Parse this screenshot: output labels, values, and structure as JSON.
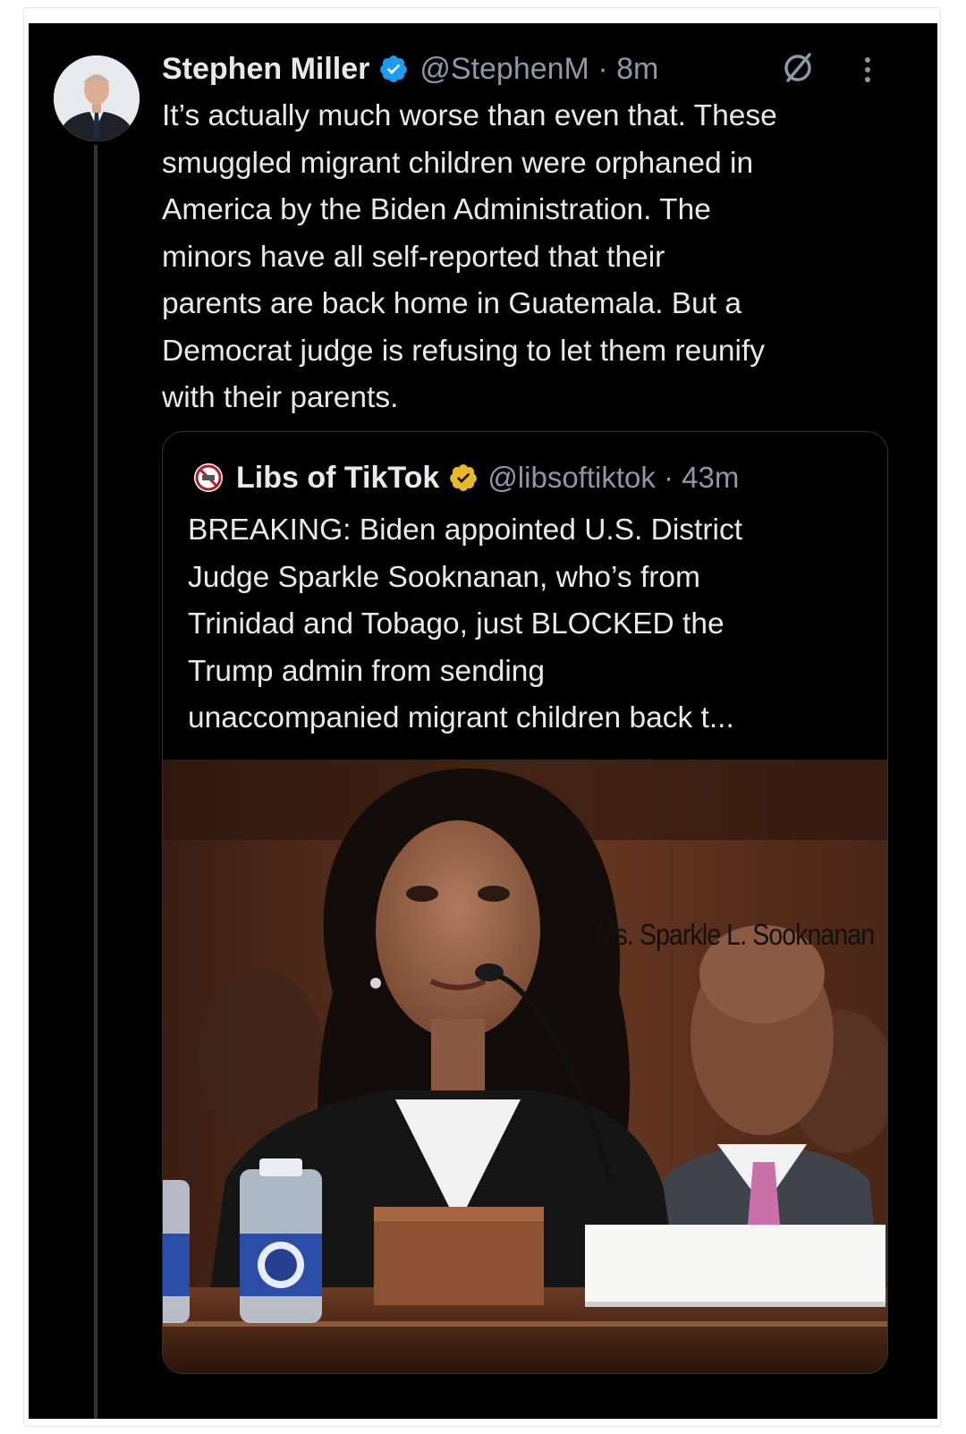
{
  "tweet": {
    "author_name": "Stephen Miller",
    "handle_time": "@StephenM · 8m",
    "verified_color": "#1d9bf0",
    "text": "It’s actually much worse than even that. These\nsmuggled migrant children were orphaned in\nAmerica by the Biden Administration. The\nminors have all self-reported that their\nparents are back home in Guatemala. But a\nDemocrat judge is refusing to let them reunify\nwith their parents.",
    "icons": [
      "avatar",
      "verified-badge-icon",
      "reply-restricted-icon",
      "more-options-icon"
    ]
  },
  "quoted_tweet": {
    "author_name": "Libs of TikTok",
    "handle_time": "@libsoftiktok · 43m",
    "verified_color": "#e8b829",
    "text": "BREAKING: Biden appointed U.S. District\nJudge Sparkle Sooknanan, who’s from\nTrinidad and Tobago, just BLOCKED the\nTrump admin from sending\nunaccompanied migrant children back t...",
    "photo": {
      "description_icon": "hearing-photo",
      "nameplate": "Ms. Sparkle L. Sooknanan"
    }
  }
}
